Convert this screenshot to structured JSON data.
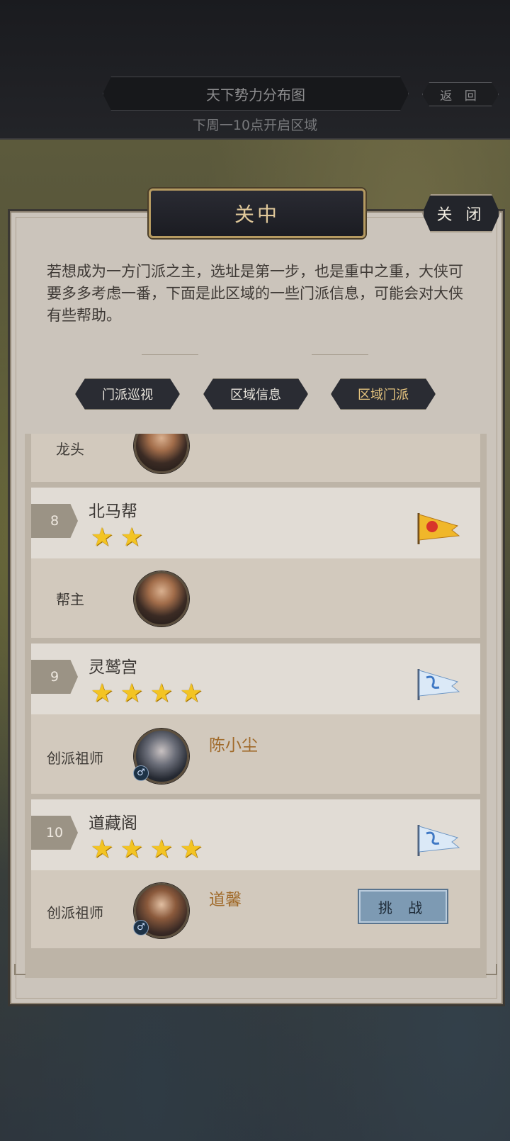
{
  "header": {
    "title": "天下势力分布图",
    "back_label": "返 回",
    "subtitle_pre": "下周一10点开启",
    "subtitle_hl": "",
    "subtitle_post": "区域"
  },
  "panel": {
    "title": "关中",
    "close_label": "关 闭",
    "description": "若想成为一方门派之主，选址是第一步，也是重中之重，大侠可要多多考虑一番，下面是此区域的一些门派信息，可能会对大侠有些帮助。",
    "tabs": [
      {
        "label": "门派巡视",
        "active": false
      },
      {
        "label": "区域信息",
        "active": false
      },
      {
        "label": "区域门派",
        "active": true
      }
    ]
  },
  "sects": [
    {
      "rank": "",
      "name": "",
      "stars": 0,
      "role": "龙头",
      "master": "",
      "partial": true
    },
    {
      "rank": "8",
      "name": "北马帮",
      "stars": 2,
      "flag": "yellow-flag-icon",
      "role": "帮主",
      "master": ""
    },
    {
      "rank": "9",
      "name": "灵鹫宫",
      "stars": 4,
      "flag": "blue-dragon-flag-icon",
      "role": "创派祖师",
      "master": "陈小尘"
    },
    {
      "rank": "10",
      "name": "道藏阁",
      "stars": 4,
      "flag": "blue-dragon-flag-icon",
      "role": "创派祖师",
      "master": "道馨",
      "challenge_label": "挑 战"
    }
  ],
  "colors": {
    "accent_gold": "#e6c57f",
    "star": "#f3c423",
    "master_name": "#a06a2a",
    "challenge_button": "#7d9ab3"
  }
}
